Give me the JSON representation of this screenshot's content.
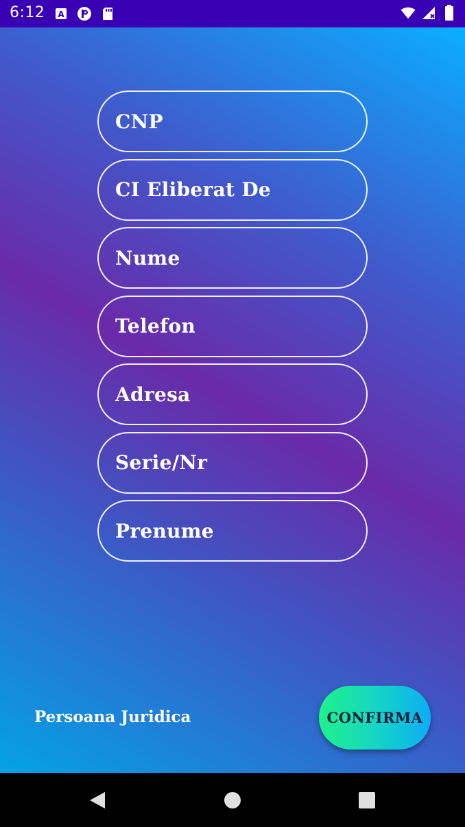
{
  "status_bar": {
    "time": "6:12",
    "left_icons": [
      "text-a-icon",
      "p-badge-icon",
      "sd-card-icon"
    ],
    "right_icons": [
      "wifi-icon",
      "signal-icon",
      "battery-icon"
    ],
    "background_color": "#3a00b4"
  },
  "form": {
    "fields": [
      {
        "label": "CNP"
      },
      {
        "label": "CI Eliberat De"
      },
      {
        "label": "Nume"
      },
      {
        "label": "Telefon"
      },
      {
        "label": "Adresa"
      },
      {
        "label": "Serie/Nr"
      },
      {
        "label": "Prenume"
      }
    ]
  },
  "footer": {
    "link_label": "Persoana Juridica",
    "confirm_label": "CONFIRMA"
  },
  "nav_bar": {
    "buttons": [
      "back-icon",
      "home-icon",
      "recents-icon"
    ]
  },
  "colors": {
    "accent_start": "#1ef28a",
    "accent_end": "#0aaef5",
    "gradient_purple": "#6a2aa9",
    "gradient_blue": "#0aaeff"
  }
}
